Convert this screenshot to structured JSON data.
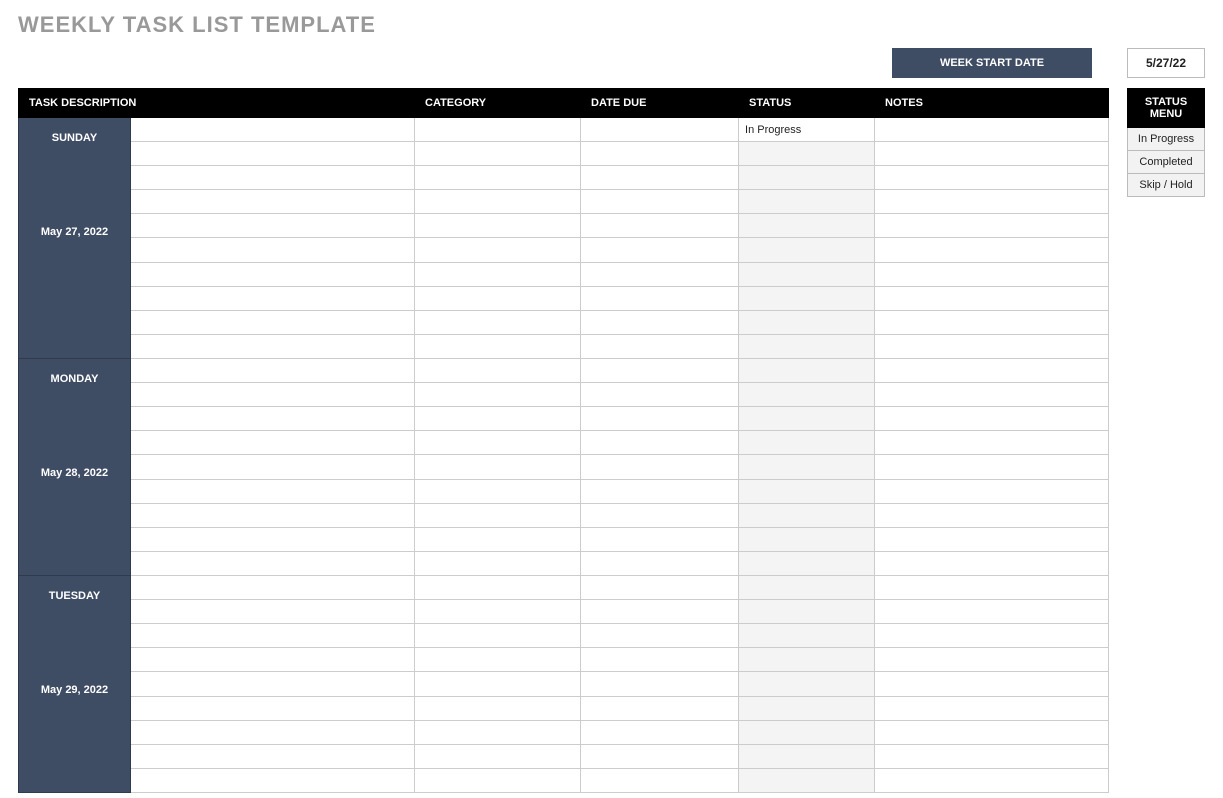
{
  "title": "WEEKLY TASK LIST TEMPLATE",
  "week_start_label": "WEEK START DATE",
  "week_start_date": "5/27/22",
  "columns": {
    "task_description": "TASK DESCRIPTION",
    "category": "CATEGORY",
    "date_due": "DATE DUE",
    "status": "STATUS",
    "notes": "NOTES"
  },
  "status_menu": {
    "header": "STATUS MENU",
    "items": [
      "In Progress",
      "Completed",
      "Skip / Hold"
    ]
  },
  "days": [
    {
      "name": "SUNDAY",
      "date": "May 27, 2022",
      "rows": [
        {
          "task": "",
          "category": "",
          "due": "",
          "status": "In Progress",
          "notes": ""
        },
        {
          "task": "",
          "category": "",
          "due": "",
          "status": "",
          "notes": ""
        },
        {
          "task": "",
          "category": "",
          "due": "",
          "status": "",
          "notes": ""
        },
        {
          "task": "",
          "category": "",
          "due": "",
          "status": "",
          "notes": ""
        },
        {
          "task": "",
          "category": "",
          "due": "",
          "status": "",
          "notes": ""
        },
        {
          "task": "",
          "category": "",
          "due": "",
          "status": "",
          "notes": ""
        },
        {
          "task": "",
          "category": "",
          "due": "",
          "status": "",
          "notes": ""
        },
        {
          "task": "",
          "category": "",
          "due": "",
          "status": "",
          "notes": ""
        },
        {
          "task": "",
          "category": "",
          "due": "",
          "status": "",
          "notes": ""
        },
        {
          "task": "",
          "category": "",
          "due": "",
          "status": "",
          "notes": ""
        }
      ]
    },
    {
      "name": "MONDAY",
      "date": "May 28, 2022",
      "rows": [
        {
          "task": "",
          "category": "",
          "due": "",
          "status": "",
          "notes": ""
        },
        {
          "task": "",
          "category": "",
          "due": "",
          "status": "",
          "notes": ""
        },
        {
          "task": "",
          "category": "",
          "due": "",
          "status": "",
          "notes": ""
        },
        {
          "task": "",
          "category": "",
          "due": "",
          "status": "",
          "notes": ""
        },
        {
          "task": "",
          "category": "",
          "due": "",
          "status": "",
          "notes": ""
        },
        {
          "task": "",
          "category": "",
          "due": "",
          "status": "",
          "notes": ""
        },
        {
          "task": "",
          "category": "",
          "due": "",
          "status": "",
          "notes": ""
        },
        {
          "task": "",
          "category": "",
          "due": "",
          "status": "",
          "notes": ""
        },
        {
          "task": "",
          "category": "",
          "due": "",
          "status": "",
          "notes": ""
        }
      ]
    },
    {
      "name": "TUESDAY",
      "date": "May 29, 2022",
      "rows": [
        {
          "task": "",
          "category": "",
          "due": "",
          "status": "",
          "notes": ""
        },
        {
          "task": "",
          "category": "",
          "due": "",
          "status": "",
          "notes": ""
        },
        {
          "task": "",
          "category": "",
          "due": "",
          "status": "",
          "notes": ""
        },
        {
          "task": "",
          "category": "",
          "due": "",
          "status": "",
          "notes": ""
        },
        {
          "task": "",
          "category": "",
          "due": "",
          "status": "",
          "notes": ""
        },
        {
          "task": "",
          "category": "",
          "due": "",
          "status": "",
          "notes": ""
        },
        {
          "task": "",
          "category": "",
          "due": "",
          "status": "",
          "notes": ""
        },
        {
          "task": "",
          "category": "",
          "due": "",
          "status": "",
          "notes": ""
        },
        {
          "task": "",
          "category": "",
          "due": "",
          "status": "",
          "notes": ""
        }
      ]
    }
  ]
}
